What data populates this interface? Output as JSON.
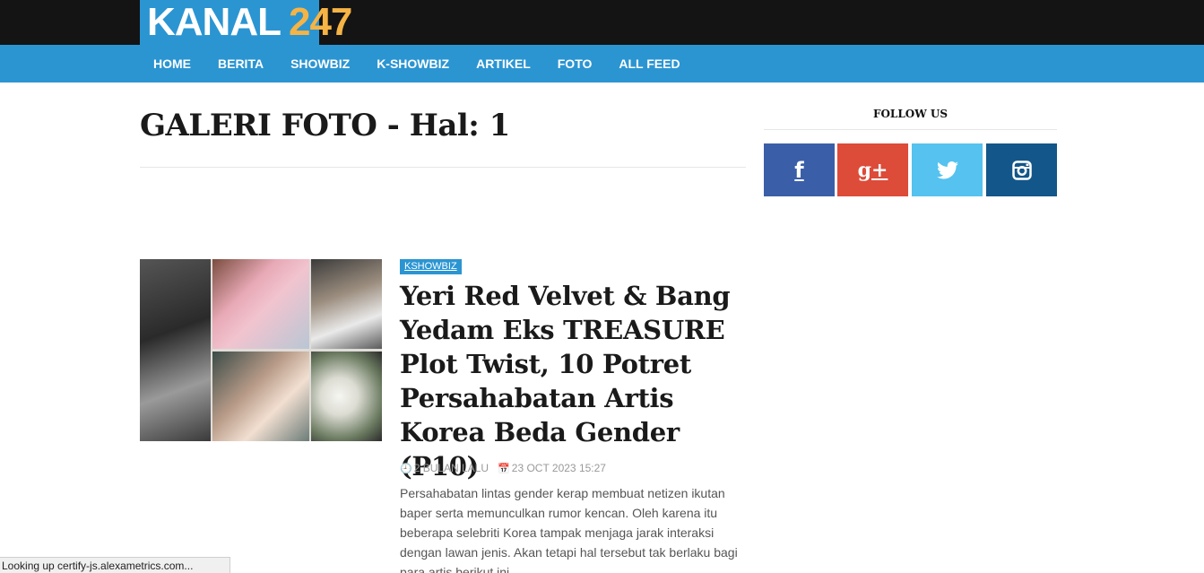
{
  "header": {
    "logo_text_main": "KANAL",
    "logo_text_num": "247",
    "colors": {
      "topbar": "#141414",
      "brand": "#2b95d2",
      "accent": "#f5b445"
    }
  },
  "nav": {
    "items": [
      {
        "label": "HOME"
      },
      {
        "label": "BERITA"
      },
      {
        "label": "SHOWBIZ"
      },
      {
        "label": "K-SHOWBIZ"
      },
      {
        "label": "ARTIKEL"
      },
      {
        "label": "FOTO"
      },
      {
        "label": "ALL FEED"
      }
    ]
  },
  "main": {
    "page_title": "GALERI FOTO - Hal: 1",
    "article": {
      "category": "KSHOWBIZ",
      "title": "Yeri Red Velvet & Bang Yedam Eks TREASURE Plot Twist, 10 Potret Persahabatan Artis Korea Beda Gender (P10)",
      "relative_time": "2 BULAN LALU",
      "date": "23 OCT 2023 15:27",
      "excerpt": "Persahabatan lintas gender kerap membuat netizen ikutan baper serta memunculkan rumor kencan. Oleh karena itu beberapa selebriti Korea tampak menjaga jarak interaksi dengan lawan jenis. Akan tetapi hal tersebut tak berlaku bagi para artis berikut ini."
    }
  },
  "sidebar": {
    "follow_title": "FOLLOW US",
    "social": [
      {
        "icon": "facebook-icon",
        "glyph": "f",
        "color": "#3b5ea8"
      },
      {
        "icon": "google-plus-icon",
        "glyph": "g+",
        "color": "#dd4b39"
      },
      {
        "icon": "twitter-icon",
        "color": "#55c2ef"
      },
      {
        "icon": "instagram-icon",
        "color": "#135689"
      }
    ]
  },
  "status_bar": {
    "text": "Looking up certify-js.alexametrics.com..."
  }
}
